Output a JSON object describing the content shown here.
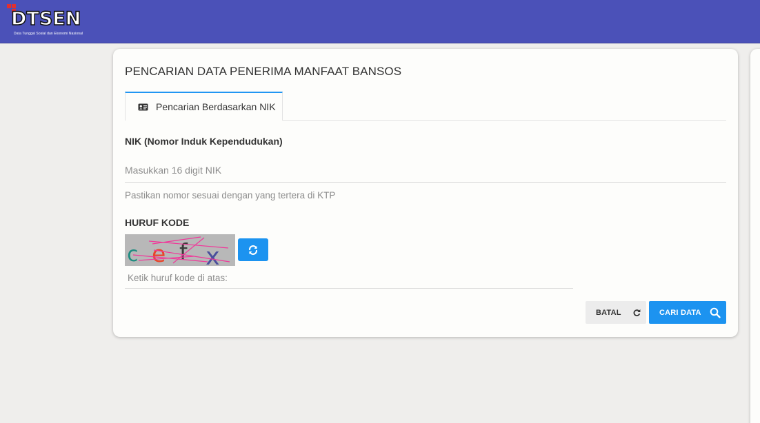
{
  "header": {
    "logo_text": "DTSEN",
    "logo_subtitle": "Data Tunggal Sosial dan Ekonomi Nasional"
  },
  "card": {
    "title": "PENCARIAN DATA PENERIMA MANFAAT BANSOS",
    "tab_label": "Pencarian Berdasarkan NIK",
    "tab_icon": "id-card-icon"
  },
  "form": {
    "nik_label": "NIK (Nomor Induk Kependudukan)",
    "nik_placeholder": "Masukkan 16 digit NIK",
    "nik_value": "",
    "nik_help": "Pastikan nomor sesuai dengan yang tertera di KTP",
    "captcha_label": "HURUF KODE",
    "captcha_chars": [
      "c",
      "e",
      "f",
      "x"
    ],
    "captcha_placeholder": "Ketik huruf kode di atas:",
    "captcha_value": "",
    "refresh_icon": "refresh-icon"
  },
  "buttons": {
    "cancel_label": "BATAL",
    "cancel_icon": "reset-icon",
    "search_label": "CARI DATA",
    "search_icon": "search-icon"
  },
  "colors": {
    "header_bg": "#4b51b8",
    "accent": "#1c93f0",
    "logo_red": "#e23030"
  }
}
